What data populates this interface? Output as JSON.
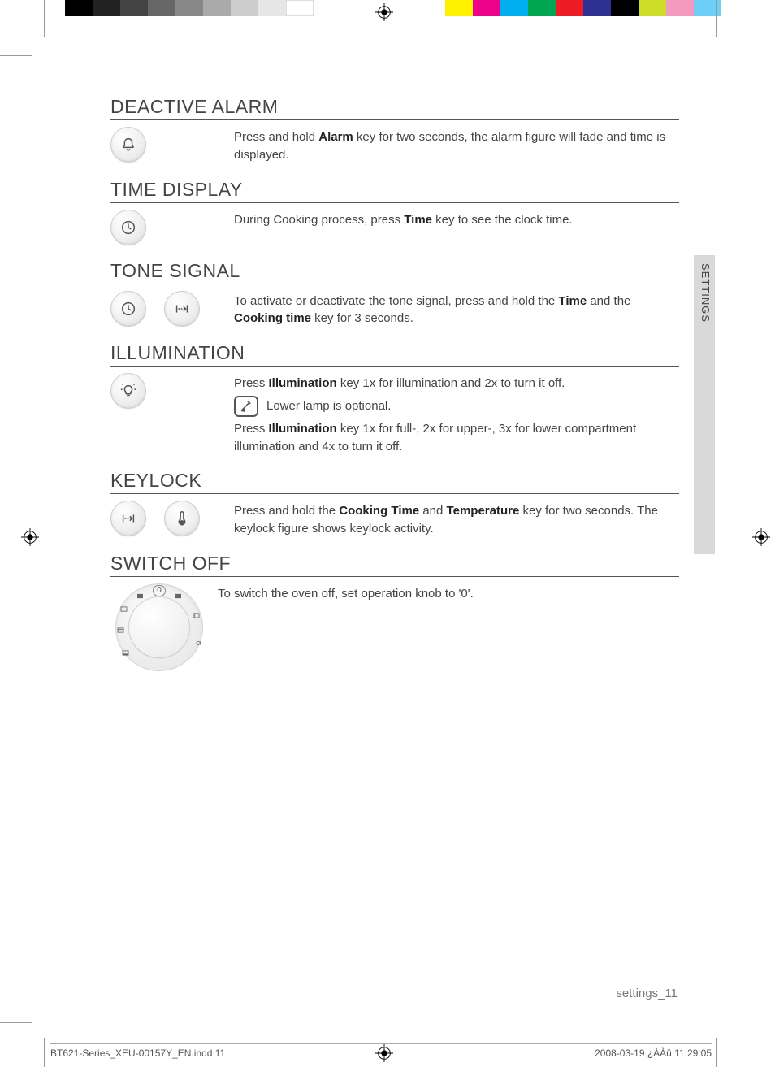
{
  "side_tab": "SETTINGS",
  "footer": "settings_11",
  "slug_left": "BT621-Series_XEU-00157Y_EN.indd   11",
  "slug_right": "2008-03-19   ¿ÀÀü 11:29:05",
  "sections": {
    "deactive_alarm": {
      "title": "DEACTIVE ALARM",
      "text_pre": "Press and hold ",
      "text_bold1": "Alarm",
      "text_post": " key for two seconds, the alarm figure will fade and time is displayed."
    },
    "time_display": {
      "title": "TIME DISPLAY",
      "text_pre": "During Cooking process, press ",
      "text_bold1": "Time",
      "text_post": " key to see the clock time."
    },
    "tone_signal": {
      "title": "TONE SIGNAL",
      "text_pre": "To activate or deactivate the tone signal, press and hold the ",
      "text_bold1": "Time",
      "text_mid": " and the ",
      "text_bold2": "Cooking time",
      "text_post": " key for 3 seconds."
    },
    "illumination": {
      "title": "ILLUMINATION",
      "line1_pre": "Press ",
      "line1_bold": "Illumination",
      "line1_post": " key 1x for illumination and 2x to turn it off.",
      "note": "Lower lamp is optional.",
      "line2_pre": "Press ",
      "line2_bold": "Illumination",
      "line2_post": " key 1x for full-, 2x for upper-, 3x for lower compartment illumination and 4x to turn it off."
    },
    "keylock": {
      "title": "KEYLOCK",
      "text_pre": "Press and hold the ",
      "text_bold1": "Cooking Time",
      "text_mid": " and ",
      "text_bold2": "Temperature",
      "text_post": " key for two seconds. The keylock figure shows keylock activity."
    },
    "switch_off": {
      "title": "SWITCH OFF",
      "text": "To switch the oven off, set operation knob to '0'.",
      "knob_zero": "0"
    }
  }
}
